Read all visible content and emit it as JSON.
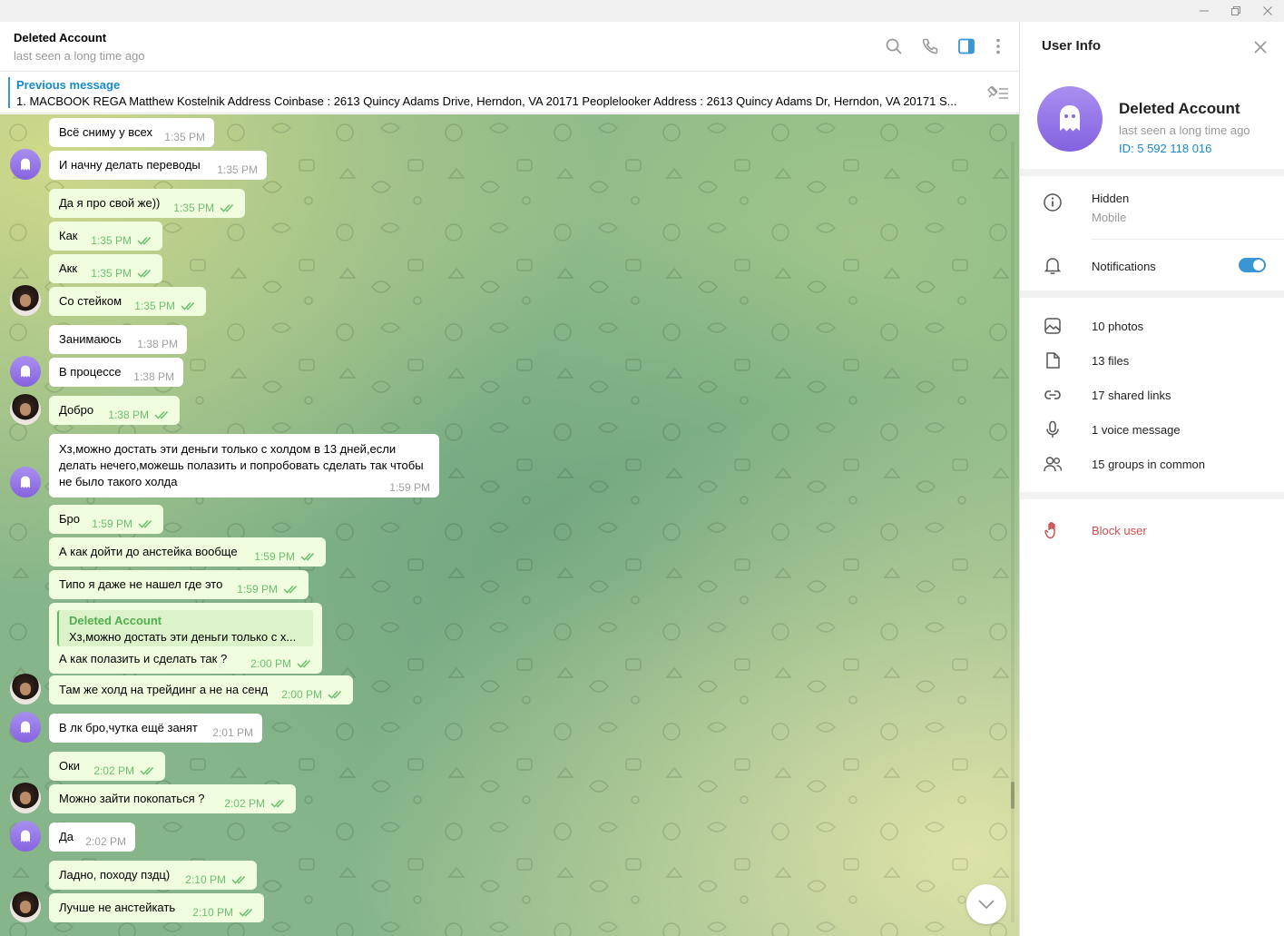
{
  "header": {
    "title": "Deleted Account",
    "status": "last seen a long time ago"
  },
  "pinned": {
    "title": "Previous message",
    "text": "1. MACBOOK REGA  Matthew Kostelnik  Address Coinbase : 2613 Quincy Adams Drive, Herndon, VA 20171   Peoplelooker Address : 2613 Quincy Adams Dr, Herndon, VA 20171 S..."
  },
  "messages": [
    {
      "dir": "in",
      "text": "Всё сниму у всех",
      "time": "1:35 PM"
    },
    {
      "dir": "in",
      "text": "И начну делать переводы",
      "time": "1:35 PM"
    },
    {
      "dir": "out",
      "text": "Да я про свой же))",
      "time": "1:35 PM"
    },
    {
      "dir": "out",
      "text": "Как",
      "time": "1:35 PM"
    },
    {
      "dir": "out",
      "text": "Акк",
      "time": "1:35 PM"
    },
    {
      "dir": "out",
      "text": "Со стейком",
      "time": "1:35 PM"
    },
    {
      "dir": "in",
      "text": "Занимаюсь",
      "time": "1:38 PM"
    },
    {
      "dir": "in",
      "text": "В процессе",
      "time": "1:38 PM"
    },
    {
      "dir": "out",
      "text": "Добро",
      "time": "1:38 PM"
    },
    {
      "dir": "in",
      "text": "Хз,можно достать эти деньги только с холдом в 13 дней,если делать нечего,можешь полазить и попробовать сделать так чтобы не было такого холда",
      "time": "1:59 PM"
    },
    {
      "dir": "out",
      "text": "Бро",
      "time": "1:59 PM"
    },
    {
      "dir": "out",
      "text": "А как дойти до анстейка вообще",
      "time": "1:59 PM"
    },
    {
      "dir": "out",
      "text": "Типо я даже не нашел где это",
      "time": "1:59 PM"
    },
    {
      "dir": "out",
      "text": "А как полазить и сделать так ?",
      "time": "2:00 PM",
      "reply_name": "Deleted Account",
      "reply_text": "Хз,можно достать эти деньги только с х..."
    },
    {
      "dir": "out",
      "text": "Там же холд на трейдинг а не на сенд",
      "time": "2:00 PM"
    },
    {
      "dir": "in",
      "text": "В лк бро,чутка ещё занят",
      "time": "2:01 PM"
    },
    {
      "dir": "out",
      "text": "Оки",
      "time": "2:02 PM"
    },
    {
      "dir": "out",
      "text": "Можно зайти покопаться ?",
      "time": "2:02 PM"
    },
    {
      "dir": "in",
      "text": "Да",
      "time": "2:02 PM"
    },
    {
      "dir": "out",
      "text": "Ладно, походу пздц)",
      "time": "2:10 PM"
    },
    {
      "dir": "out",
      "text": "Лучше не анстейкать",
      "time": "2:10 PM"
    }
  ],
  "side": {
    "title": "User Info",
    "name": "Deleted Account",
    "status": "last seen a long time ago",
    "id": "ID: 5 592 118 016",
    "phone_label": "Hidden",
    "phone_sub": "Mobile",
    "notifications_label": "Notifications",
    "notifications_on": true,
    "media": {
      "photos": "10 photos",
      "files": "13 files",
      "links": "17 shared links",
      "voice": "1 voice message",
      "groups": "15 groups in common"
    },
    "block_label": "Block user"
  },
  "colors": {
    "accent": "#168acd",
    "out_bubble": "#effdde",
    "in_bubble": "#ffffff",
    "check": "#6dbf6f",
    "danger": "#d14e4e"
  }
}
